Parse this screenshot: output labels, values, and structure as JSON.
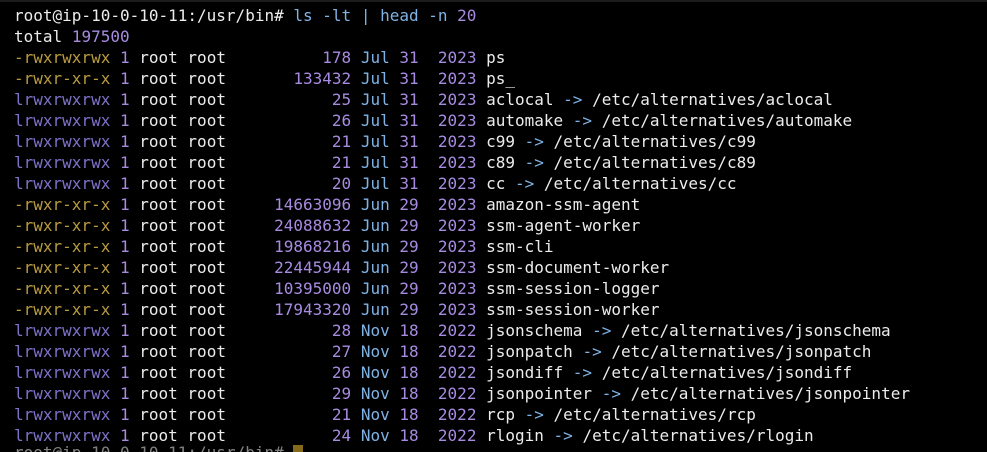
{
  "prompt": {
    "user_host_path": "root@ip-10-0-10-11:/usr/bin#",
    "partial": "root@ip-10-0-10-11:/usr/bin#"
  },
  "command": {
    "ls": "ls",
    "flag": "-lt",
    "pipe": "|",
    "head": "head",
    "head_flag": "-n",
    "head_count": "20"
  },
  "total": {
    "label": "total",
    "value": "197500"
  },
  "rows": [
    {
      "perm": "-rwxrwxrwx",
      "links": "1",
      "owner": "root",
      "group": "root",
      "size": "178",
      "month": "Jul",
      "day": "31",
      "year": "2023",
      "name": "ps",
      "arrow": "",
      "target": ""
    },
    {
      "perm": "-rwxr-xr-x",
      "links": "1",
      "owner": "root",
      "group": "root",
      "size": "133432",
      "month": "Jul",
      "day": "31",
      "year": "2023",
      "name": "ps_",
      "arrow": "",
      "target": ""
    },
    {
      "perm": "lrwxrwxrwx",
      "links": "1",
      "owner": "root",
      "group": "root",
      "size": "25",
      "month": "Jul",
      "day": "31",
      "year": "2023",
      "name": "aclocal",
      "arrow": "->",
      "target": "/etc/alternatives/aclocal"
    },
    {
      "perm": "lrwxrwxrwx",
      "links": "1",
      "owner": "root",
      "group": "root",
      "size": "26",
      "month": "Jul",
      "day": "31",
      "year": "2023",
      "name": "automake",
      "arrow": "->",
      "target": "/etc/alternatives/automake"
    },
    {
      "perm": "lrwxrwxrwx",
      "links": "1",
      "owner": "root",
      "group": "root",
      "size": "21",
      "month": "Jul",
      "day": "31",
      "year": "2023",
      "name": "c99",
      "arrow": "->",
      "target": "/etc/alternatives/c99"
    },
    {
      "perm": "lrwxrwxrwx",
      "links": "1",
      "owner": "root",
      "group": "root",
      "size": "21",
      "month": "Jul",
      "day": "31",
      "year": "2023",
      "name": "c89",
      "arrow": "->",
      "target": "/etc/alternatives/c89"
    },
    {
      "perm": "lrwxrwxrwx",
      "links": "1",
      "owner": "root",
      "group": "root",
      "size": "20",
      "month": "Jul",
      "day": "31",
      "year": "2023",
      "name": "cc",
      "arrow": "->",
      "target": "/etc/alternatives/cc"
    },
    {
      "perm": "-rwxr-xr-x",
      "links": "1",
      "owner": "root",
      "group": "root",
      "size": "14663096",
      "month": "Jun",
      "day": "29",
      "year": "2023",
      "name": "amazon-ssm-agent",
      "arrow": "",
      "target": ""
    },
    {
      "perm": "-rwxr-xr-x",
      "links": "1",
      "owner": "root",
      "group": "root",
      "size": "24088632",
      "month": "Jun",
      "day": "29",
      "year": "2023",
      "name": "ssm-agent-worker",
      "arrow": "",
      "target": ""
    },
    {
      "perm": "-rwxr-xr-x",
      "links": "1",
      "owner": "root",
      "group": "root",
      "size": "19868216",
      "month": "Jun",
      "day": "29",
      "year": "2023",
      "name": "ssm-cli",
      "arrow": "",
      "target": ""
    },
    {
      "perm": "-rwxr-xr-x",
      "links": "1",
      "owner": "root",
      "group": "root",
      "size": "22445944",
      "month": "Jun",
      "day": "29",
      "year": "2023",
      "name": "ssm-document-worker",
      "arrow": "",
      "target": ""
    },
    {
      "perm": "-rwxr-xr-x",
      "links": "1",
      "owner": "root",
      "group": "root",
      "size": "10395000",
      "month": "Jun",
      "day": "29",
      "year": "2023",
      "name": "ssm-session-logger",
      "arrow": "",
      "target": ""
    },
    {
      "perm": "-rwxr-xr-x",
      "links": "1",
      "owner": "root",
      "group": "root",
      "size": "17943320",
      "month": "Jun",
      "day": "29",
      "year": "2023",
      "name": "ssm-session-worker",
      "arrow": "",
      "target": ""
    },
    {
      "perm": "lrwxrwxrwx",
      "links": "1",
      "owner": "root",
      "group": "root",
      "size": "28",
      "month": "Nov",
      "day": "18",
      "year": "2022",
      "name": "jsonschema",
      "arrow": "->",
      "target": "/etc/alternatives/jsonschema"
    },
    {
      "perm": "lrwxrwxrwx",
      "links": "1",
      "owner": "root",
      "group": "root",
      "size": "27",
      "month": "Nov",
      "day": "18",
      "year": "2022",
      "name": "jsonpatch",
      "arrow": "->",
      "target": "/etc/alternatives/jsonpatch"
    },
    {
      "perm": "lrwxrwxrwx",
      "links": "1",
      "owner": "root",
      "group": "root",
      "size": "26",
      "month": "Nov",
      "day": "18",
      "year": "2022",
      "name": "jsondiff",
      "arrow": "->",
      "target": "/etc/alternatives/jsondiff"
    },
    {
      "perm": "lrwxrwxrwx",
      "links": "1",
      "owner": "root",
      "group": "root",
      "size": "29",
      "month": "Nov",
      "day": "18",
      "year": "2022",
      "name": "jsonpointer",
      "arrow": "->",
      "target": "/etc/alternatives/jsonpointer"
    },
    {
      "perm": "lrwxrwxrwx",
      "links": "1",
      "owner": "root",
      "group": "root",
      "size": "21",
      "month": "Nov",
      "day": "18",
      "year": "2022",
      "name": "rcp",
      "arrow": "->",
      "target": "/etc/alternatives/rcp"
    },
    {
      "perm": "lrwxrwxrwx",
      "links": "1",
      "owner": "root",
      "group": "root",
      "size": "24",
      "month": "Nov",
      "day": "18",
      "year": "2022",
      "name": "rlogin",
      "arrow": "->",
      "target": "/etc/alternatives/rlogin"
    }
  ],
  "colors": {
    "background": "#000000",
    "text": "#ececec",
    "command_cyan": "#7fb3e6",
    "number_purple": "#a78be0",
    "symlink_perm": "#7d71c8",
    "file_perm": "#b89a3f",
    "cursor": "#f1c232"
  }
}
